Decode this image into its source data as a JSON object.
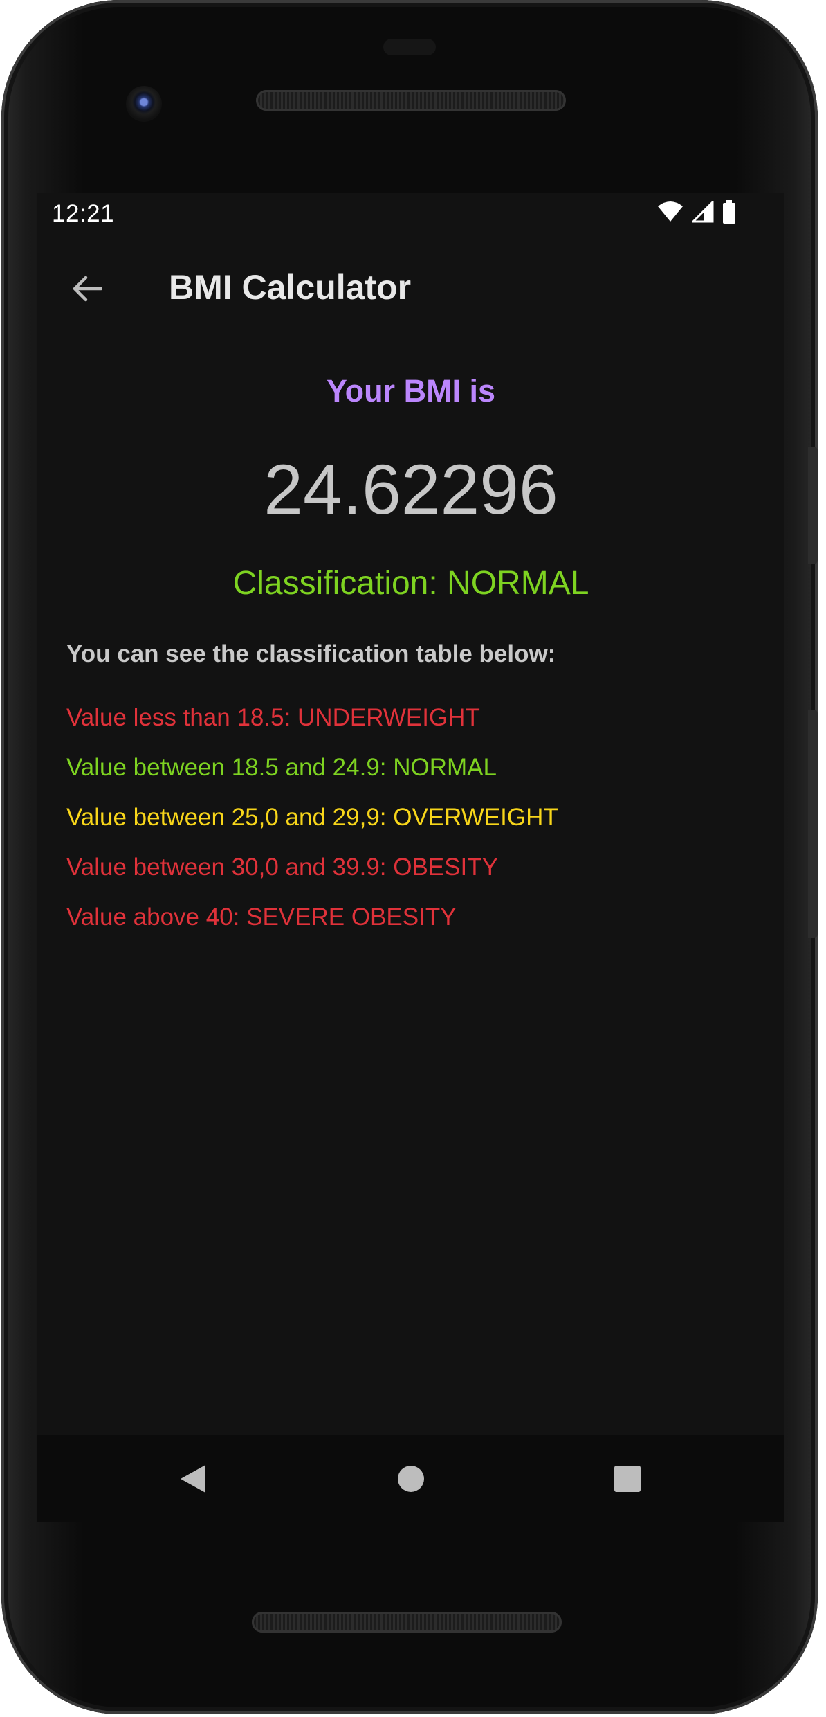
{
  "status_bar": {
    "time": "12:21",
    "icons": [
      "wifi-icon",
      "cell-signal-icon",
      "battery-icon"
    ]
  },
  "app_bar": {
    "title": "BMI Calculator",
    "back_icon": "arrow-left-icon"
  },
  "result": {
    "heading": "Your BMI is",
    "value": "24.62296",
    "classification": "Classification: NORMAL"
  },
  "table": {
    "intro": "You can see the classification table below:",
    "rows": [
      {
        "text": "Value less than 18.5: UNDERWEIGHT",
        "color": "#e0323a"
      },
      {
        "text": "Value between 18.5 and 24.9: NORMAL",
        "color": "#7ed321"
      },
      {
        "text": "Value between 25,0 and 29,9: OVERWEIGHT",
        "color": "#f8d61a"
      },
      {
        "text": "Value between 30,0 and 39.9: OBESITY",
        "color": "#e0323a"
      },
      {
        "text": "Value above 40: SEVERE OBESITY",
        "color": "#e0323a"
      }
    ]
  },
  "colors": {
    "background": "#121212",
    "accent": "#bb86fc",
    "normal": "#7ed321",
    "value_text": "#c7c7c7"
  },
  "nav_bar": {
    "icons": [
      "nav-back-icon",
      "nav-home-icon",
      "nav-recents-icon"
    ]
  }
}
